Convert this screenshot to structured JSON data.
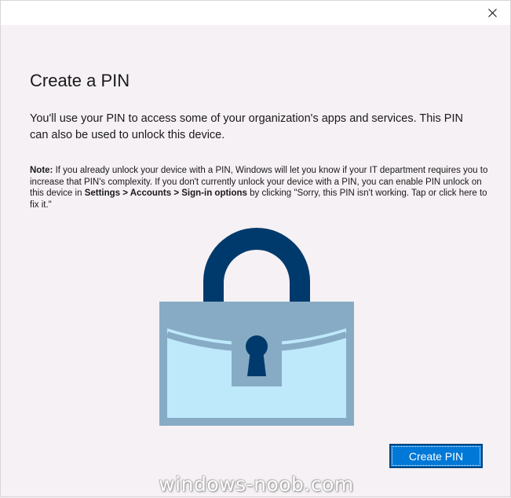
{
  "window": {
    "close_icon": "close-icon"
  },
  "dialog": {
    "title": "Create a PIN",
    "intro": "You'll use your PIN to access some of your organization's apps and services. This PIN can also be used to unlock this device.",
    "note": {
      "label": "Note:",
      "text1": " If you already unlock your device with a PIN, Windows will let you know if your IT department requires you to increase that PIN's complexity. If you don't currently unlock your device with a PIN, you can enable PIN unlock on this device in ",
      "path_settings": "Settings",
      "sep1": " > ",
      "path_accounts": "Accounts",
      "sep2": " > ",
      "path_signin": "Sign-in options",
      "text2": " by clicking \"Sorry, this PIN isn't working. Tap or click here to fix it.\""
    },
    "illustration": "padlock-icon",
    "create_button": "Create PIN"
  },
  "watermark": "windows-noob.com",
  "colors": {
    "accent": "#0078d7",
    "shackle": "#003a6c",
    "lock_body": "#bde9fb",
    "lock_frame": "#87abc5"
  }
}
